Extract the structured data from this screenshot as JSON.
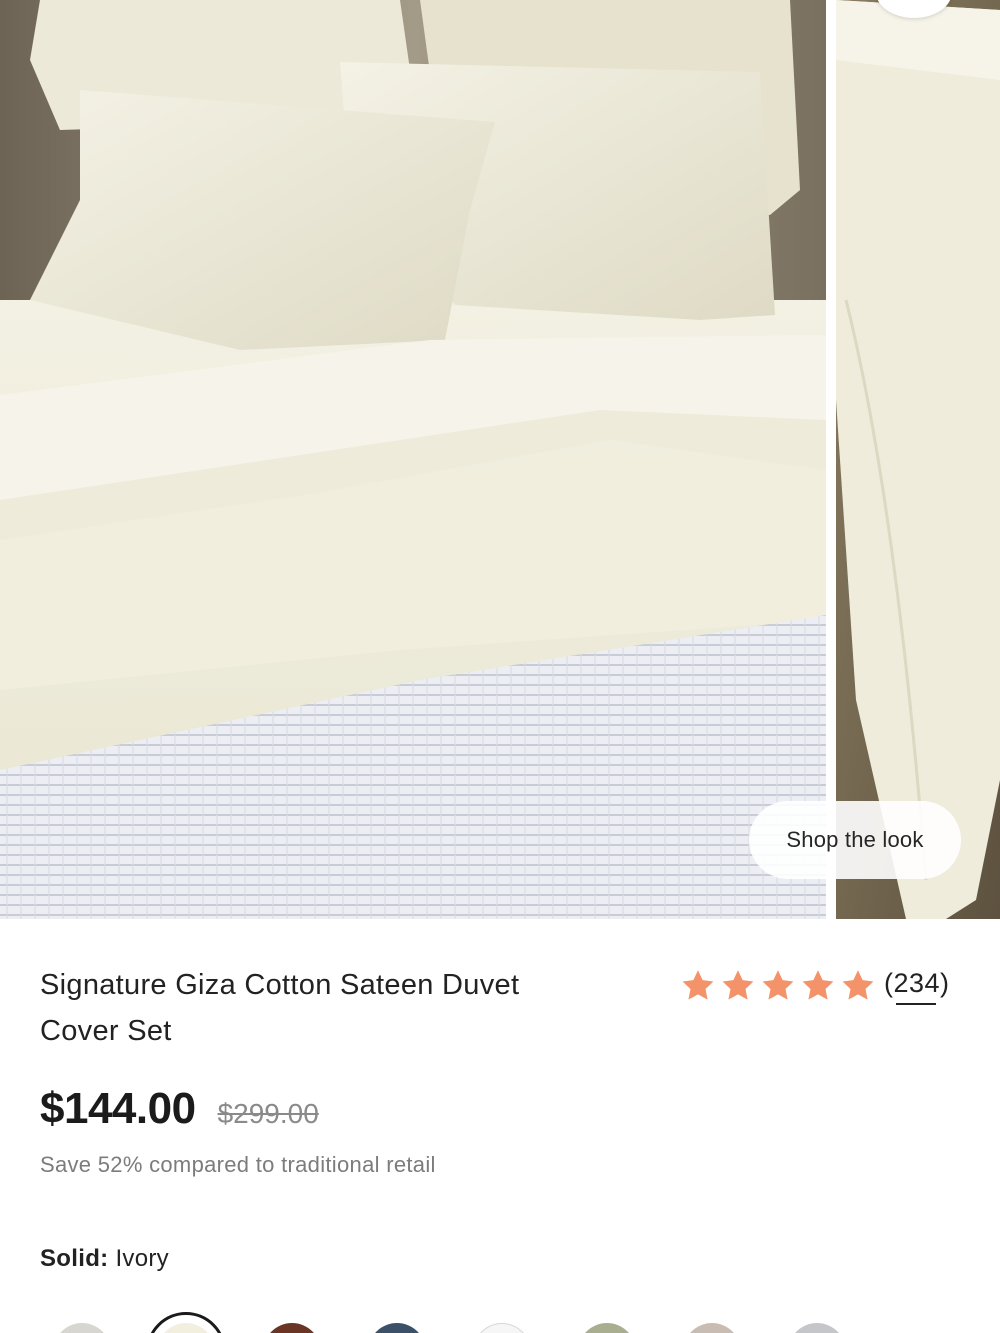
{
  "gallery": {
    "primary_image": "ivory duvet bedding with pillows and white textured quilt",
    "secondary_image": "ivory bedding close-up",
    "shop_the_look_label": "Shop the look"
  },
  "product": {
    "title": "Signature Giza Cotton Sateen Duvet Cover Set",
    "rating": {
      "stars": 5,
      "max": 5,
      "count_label": "(234)",
      "color": "#f4936a"
    },
    "price": "$144.00",
    "original_price": "$299.00",
    "savings_text": "Save 52% compared to traditional retail",
    "color_option": {
      "label": "Solid:",
      "value": "Ivory"
    }
  },
  "swatches": [
    {
      "name": "light-gray",
      "color": "#d8d6d0"
    },
    {
      "name": "ivory",
      "color": "#f2efdf",
      "selected": true
    },
    {
      "name": "brown",
      "color": "#6b3526"
    },
    {
      "name": "navy",
      "color": "#3c5068"
    },
    {
      "name": "white",
      "color": "#f6f6f6"
    },
    {
      "name": "sage",
      "color": "#a9ae91"
    },
    {
      "name": "taupe",
      "color": "#c9bcb2"
    },
    {
      "name": "silver",
      "color": "#c4c6c9"
    }
  ]
}
